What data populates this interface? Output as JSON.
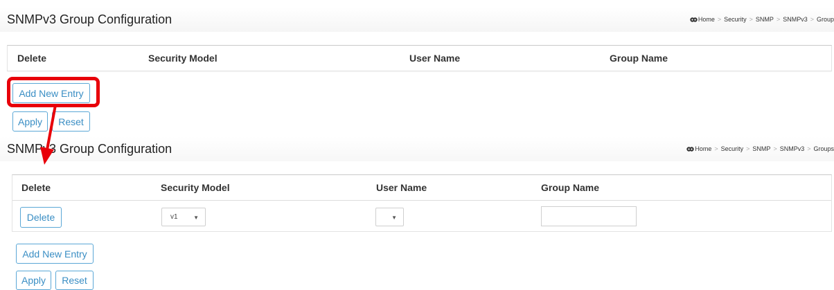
{
  "top_panel": {
    "title": "SNMPv3 Group Configuration",
    "breadcrumb": [
      "Home",
      "Security",
      "SNMP",
      "SNMPv3",
      "Group"
    ],
    "breadcrumb_separator": ">",
    "columns": [
      "Delete",
      "Security Model",
      "User Name",
      "Group Name"
    ],
    "buttons": {
      "add_new_entry": "Add New Entry",
      "apply": "Apply",
      "reset": "Reset"
    }
  },
  "bottom_panel": {
    "title": "SNMPv3 Group Configuration",
    "breadcrumb": [
      "Home",
      "Security",
      "SNMP",
      "SNMPv3",
      "Groups"
    ],
    "breadcrumb_separator": ">",
    "columns": [
      "Delete",
      "Security Model",
      "User Name",
      "Group Name"
    ],
    "row": {
      "delete_label": "Delete",
      "security_model_value": "v1",
      "user_name_value": "",
      "group_name_value": ""
    },
    "buttons": {
      "add_new_entry": "Add New Entry",
      "apply": "Apply",
      "reset": "Reset"
    }
  },
  "icons": {
    "home": "home-icon",
    "dropdown": "chevron-down-icon"
  },
  "colors": {
    "accent": "#3a8ec4",
    "annotation": "#e8000a"
  }
}
